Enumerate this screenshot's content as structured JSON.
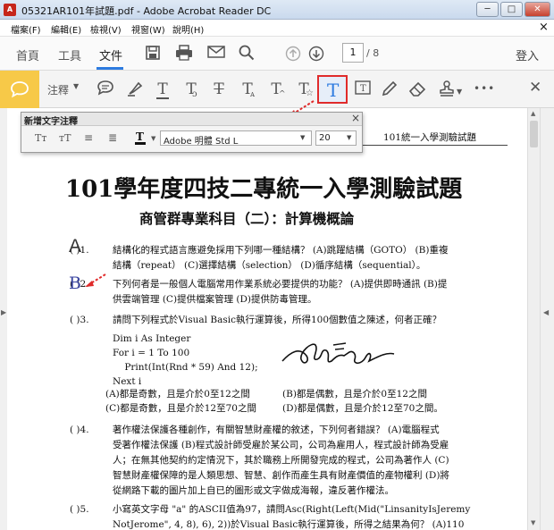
{
  "window": {
    "title": "05321AR101年試題.pdf - Adobe Acrobat Reader DC",
    "minimize": "─",
    "maximize": "□",
    "close": "✕"
  },
  "menubar": {
    "items": [
      "檔案(F)",
      "編輯(E)",
      "檢視(V)",
      "視窗(W)",
      "說明(H)"
    ],
    "close": "×"
  },
  "toolbar": {
    "home": "首頁",
    "tools": "工具",
    "document": "文件",
    "page_current": "1",
    "page_total": "/ 8",
    "signin": "登入"
  },
  "comment_toolbar": {
    "label": "注釋",
    "more": "•••",
    "close": "✕"
  },
  "popup": {
    "title": "新增文字注釋",
    "close": "×",
    "font": "Adobe 明體 Std L",
    "size": "20"
  },
  "document": {
    "header_right": "101統一入學測驗試題",
    "title": "101學年度四技二專統一入學測驗試題",
    "subtitle": "商管群專業科目（二）：計算機概論",
    "answer1": "A",
    "answer2": "B",
    "questions": [
      {
        "num": "(        )1.",
        "lines": [
          "結構化的程式語言應避免採用下列哪一種結構？  (A)跳躍結構（GOTO）  (B)重複",
          "結構（repeat）  (C)選擇結構（selection）  (D)循序結構（sequential）。"
        ]
      },
      {
        "num": "(        )2.",
        "lines": [
          "下列何者是一般個人電腦常用作業系統必要提供的功能？  (A)提供即時通訊  (B)提",
          "供雲端管理  (C)提供檔案管理  (D)提供防毒管理。"
        ]
      },
      {
        "num": "(        )3.",
        "lines": [
          "請問下列程式於Visual Basic執行運算後，所得100個數值之陳述，何者正確？"
        ]
      },
      {
        "num": "(        )4.",
        "lines": [
          "著作權法保護各種創作，有關智慧財產權的敘述，下列何者錯誤？  (A)電腦程式",
          "受著作權法保護  (B)程式設計師受雇於某公司，公司為雇用人，程式設計師為受雇",
          "人；在無其他契約約定情況下，其於職務上所開發完成的程式，公司為著作人  (C)",
          "智慧財產權保障的是人類思想、智慧、創作而產生具有財產價值的產物權利  (D)將",
          "從網路下載的圖片加上自已的圖形或文字做成海報，違反著作權法。"
        ]
      },
      {
        "num": "(        )5.",
        "lines": [
          "小寫英文字母 \"a\" 的ASCII值為97，請問Asc(Right(Left(Mid(\"LinsanityIsJeremy",
          "NotJerome\", 4, 8), 6), 2))於Visual Basic執行運算後，所得之結果為何？  (A)110"
        ]
      }
    ],
    "code": [
      "Dim i As Integer",
      "For i = 1 To 100",
      "    Print(Int(Rnd * 59) And 12);",
      "Next i"
    ],
    "q3_options": [
      "(A)都是奇數，且是介於0至12之間",
      "(B)都是偶數，且是介於0至12之間",
      "(C)都是奇數，且是介於12至70之間",
      "(D)都是偶數，且是介於12至70之間。"
    ]
  }
}
